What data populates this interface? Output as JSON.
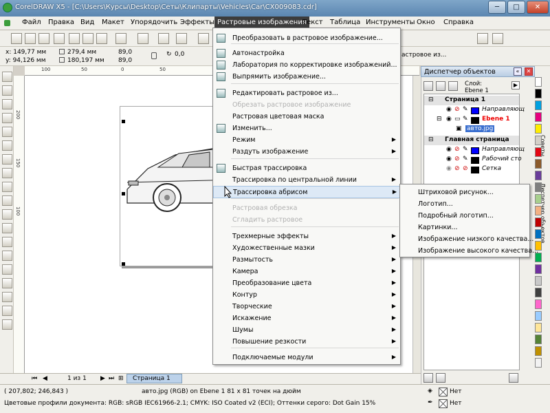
{
  "window": {
    "title": "CorelDRAW X5 - [C:\\Users\\Курсы\\Desktop\\Сеты\\Клипарты\\Vehicles\\Car\\CX009083.cdr]",
    "controls": {
      "minimize": "─",
      "maximize": "□",
      "close": "✕"
    }
  },
  "menubar": {
    "items": [
      "Файл",
      "Правка",
      "Вид",
      "Макет",
      "Упорядочить",
      "Эффекты",
      "Растровые изображения",
      "Текст",
      "Таблица",
      "Инструменты",
      "Окно",
      "Справка"
    ],
    "active": "Растровые изображения"
  },
  "propbar": {
    "x": "x: 149,77 мм",
    "y": "y: 94,126 мм",
    "w": "279,4 мм",
    "h": "180,197 мм",
    "scale_x": "89,0",
    "scale_y": "89,0",
    "angle": "0,0",
    "hidden_text": "астровое из..."
  },
  "ruler": {
    "h_labels": [
      "100",
      "50",
      "0",
      "50"
    ],
    "v_labels": [
      "200",
      "150",
      "100"
    ]
  },
  "bitmap_menu": {
    "items": [
      {
        "label": "Преобразовать в растровое изображение...",
        "enabled": true,
        "submenu": false,
        "icon": "convert-bitmap-icon"
      },
      {
        "label": "Автонастройка",
        "enabled": true,
        "submenu": false,
        "icon": "auto-adjust-icon"
      },
      {
        "label": "Лаборатория по корректировке изображений...",
        "enabled": true,
        "submenu": false,
        "icon": "image-adjustment-lab-icon"
      },
      {
        "label": "Выпрямить изображение...",
        "enabled": true,
        "submenu": false,
        "icon": "straighten-icon"
      },
      {
        "label": "Редактировать растровое из...",
        "enabled": true,
        "submenu": false,
        "icon": "edit-bitmap-icon"
      },
      {
        "label": "Обрезать растровое изображение",
        "enabled": false,
        "submenu": false,
        "icon": ""
      },
      {
        "label": "Растровая цветовая маска",
        "enabled": true,
        "submenu": false,
        "icon": ""
      },
      {
        "label": "Изменить...",
        "enabled": true,
        "submenu": false,
        "icon": "resample-icon"
      },
      {
        "label": "Режим",
        "enabled": true,
        "submenu": true,
        "icon": ""
      },
      {
        "label": "Раздуть изображение",
        "enabled": true,
        "submenu": true,
        "icon": ""
      },
      {
        "label": "Быстрая трассировка",
        "enabled": true,
        "submenu": false,
        "icon": "quick-trace-icon"
      },
      {
        "label": "Трассировка по центральной линии",
        "enabled": true,
        "submenu": true,
        "icon": ""
      },
      {
        "label": "Трассировка абрисом",
        "enabled": true,
        "submenu": true,
        "icon": ""
      },
      {
        "label": "Растровая обрезка",
        "enabled": false,
        "submenu": false,
        "icon": ""
      },
      {
        "label": "Сгладить растровое",
        "enabled": false,
        "submenu": false,
        "icon": ""
      },
      {
        "label": "Трехмерные эффекты",
        "enabled": true,
        "submenu": true,
        "icon": ""
      },
      {
        "label": "Художественные мазки",
        "enabled": true,
        "submenu": true,
        "icon": ""
      },
      {
        "label": "Размытость",
        "enabled": true,
        "submenu": true,
        "icon": ""
      },
      {
        "label": "Камера",
        "enabled": true,
        "submenu": true,
        "icon": ""
      },
      {
        "label": "Преобразование цвета",
        "enabled": true,
        "submenu": true,
        "icon": ""
      },
      {
        "label": "Контур",
        "enabled": true,
        "submenu": true,
        "icon": ""
      },
      {
        "label": "Творческие",
        "enabled": true,
        "submenu": true,
        "icon": ""
      },
      {
        "label": "Искажение",
        "enabled": true,
        "submenu": true,
        "icon": ""
      },
      {
        "label": "Шумы",
        "enabled": true,
        "submenu": true,
        "icon": ""
      },
      {
        "label": "Повышение резкости",
        "enabled": true,
        "submenu": true,
        "icon": ""
      },
      {
        "label": "Подключаемые модули",
        "enabled": true,
        "submenu": true,
        "icon": ""
      }
    ],
    "highlighted": "Трассировка абрисом"
  },
  "outline_trace_submenu": {
    "items": [
      "Штриховой рисунок...",
      "Логотип...",
      "Подробный логотип...",
      "Картинки...",
      "Изображение низкого качества...",
      "Изображение высокого качества..."
    ]
  },
  "object_manager": {
    "title": "Диспетчер объектов",
    "layer_label": "Слой:",
    "layer_name": "Ebene 1",
    "rows": [
      {
        "text": "Страница 1",
        "kind": "page",
        "color": "#000000"
      },
      {
        "text": "Направляющ",
        "kind": "layer",
        "color": "#0000ff"
      },
      {
        "text": "Ebene 1",
        "kind": "layer-active",
        "color": "#ff0000"
      },
      {
        "text": "авто.jpg",
        "kind": "object",
        "color": "#000000"
      },
      {
        "text": "Главная страница",
        "kind": "page",
        "color": "#000000"
      },
      {
        "text": "Направляющ",
        "kind": "layer",
        "color": "#0000ff"
      },
      {
        "text": "Рабочий сто",
        "kind": "layer",
        "color": "#000000"
      },
      {
        "text": "Сетка",
        "kind": "layer",
        "color": "#000000"
      }
    ],
    "side_tabs": [
      "Советы",
      "Диспетчер объектов"
    ]
  },
  "page_nav": {
    "counter": "1 из 1",
    "tab": "Страница 1"
  },
  "status": {
    "coords": "( 207,802; 246,843 )",
    "object_info": "авто.jpg (RGB) on Ebene 1 81 x 81 точек на дюйм",
    "color_profiles": "Цветовые профили документа: RGB: sRGB IEC61966-2.1; CMYK: ISO Coated v2 (ECI); Оттенки серого: Dot Gain 15%",
    "fill_label": "Нет",
    "outline_label": "Нет"
  },
  "palette": {
    "colors": [
      "#ffffff",
      "#000000",
      "#00a0e0",
      "#e6007e",
      "#ffed00",
      "#d4d0c8",
      "#e30613",
      "#8b5a2b",
      "#6a3d9a",
      "#7f7f7f",
      "#a8d08d",
      "#f4b183",
      "#c00000",
      "#0070c0",
      "#ffc000",
      "#00b050",
      "#7030a0",
      "#c9c9c9",
      "#404040",
      "#ff66cc",
      "#99ccff",
      "#ffe699",
      "#548235",
      "#bf9000",
      "#f2f2f2"
    ]
  },
  "accent_colors": {
    "menu_highlight": "#dde9f6",
    "active_menu": "#3c3c3c",
    "title_bar": "#5b86b0"
  }
}
